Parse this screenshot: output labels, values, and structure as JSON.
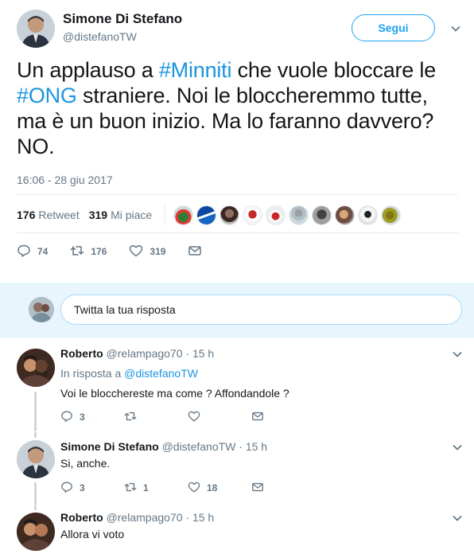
{
  "tweet": {
    "author_name": "Simone Di Stefano",
    "author_handle": "@distefanoTW",
    "follow_label": "Segui",
    "text_parts": [
      "Un applauso a ",
      "#Minniti",
      " che vuole bloccare le ",
      "#ONG",
      " straniere. Noi le bloccheremmo tutte, ma è un buon inizio. Ma lo faranno davvero? NO."
    ],
    "timestamp": "16:06 - 28 giu 2017",
    "retweet_count": "176",
    "retweet_label": "Retweet",
    "like_count": "319",
    "like_label": "Mi piace",
    "actions": {
      "reply_count": "74",
      "retweet_count": "176",
      "like_count": "319"
    }
  },
  "reply_box": {
    "placeholder": "Twitta la tua risposta"
  },
  "replies": [
    {
      "name": "Roberto",
      "handle": "@relampago70",
      "time": "· 15 h",
      "in_reply_prefix": "In risposta a ",
      "in_reply_to": "@distefanoTW",
      "text": "Voi le blocchereste ma come ? Affondandole ?",
      "reply_count": "3",
      "retweet_count": "",
      "like_count": ""
    },
    {
      "name": "Simone Di Stefano",
      "handle": "@distefanoTW",
      "time": "· 15 h",
      "text": "Si, anche.",
      "reply_count": "3",
      "retweet_count": "1",
      "like_count": "18"
    },
    {
      "name": "Roberto",
      "handle": "@relampago70",
      "time": "· 15 h",
      "text": "Allora vi voto"
    }
  ],
  "colors": {
    "accent": "#1da1f2",
    "link": "#1b95e0",
    "muted": "#657786",
    "reply_bg": "#e8f5fd"
  }
}
